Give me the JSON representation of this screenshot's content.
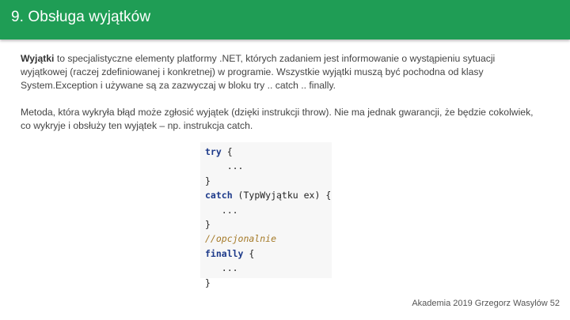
{
  "slide": {
    "title": "9. Obsługa wyjątków",
    "paragraph1": {
      "bold_lead": "Wyjątki",
      "rest": " to specjalistyczne elementy platformy .NET, których zadaniem jest informowanie o wystąpieniu sytuacji wyjątkowej (raczej zdefiniowanej i konkretnej) w programie. Wszystkie wyjątki muszą być pochodna od klasy System.Exception i używane są za zazwyczaj w bloku try .. catch .. finally."
    },
    "paragraph2": "Metoda, która wykryła błąd może zgłosić wyjątek (dzięki instrukcji throw). Nie ma jednak gwarancji, że będzie cokolwiek, co wykryje i obsłuży ten wyjątek – np. instrukcja catch.",
    "code": {
      "kw_try": "try",
      "brace_open_1": " {",
      "ellipsis_1": "    ...",
      "brace_close_1": "}",
      "kw_catch": "catch",
      "catch_rest": " (TypWyjątku ex) {",
      "ellipsis_2": "   ...",
      "brace_close_2": "}",
      "comment": "//opcjonalnie",
      "kw_finally": "finally",
      "brace_open_3": " {",
      "ellipsis_3": "   ...",
      "brace_close_3": "}"
    },
    "footer": "Akademia 2019 Grzegorz Wasylów 52"
  },
  "colors": {
    "header_bg": "#1f9d55",
    "keyword": "#1d3a8a",
    "comment": "#a57a28"
  }
}
